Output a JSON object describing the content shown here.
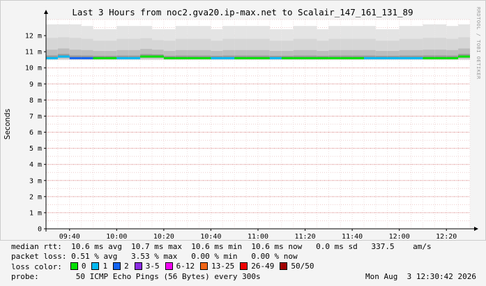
{
  "chart_data": {
    "type": "area",
    "title": "Last 3 Hours from noc2.gva20.ip-max.net to Scalair_147_161_131_89",
    "ylabel": "Seconds",
    "ylim": [
      0,
      0.013
    ],
    "yticks": [
      {
        "value": 0,
        "label": "0"
      },
      {
        "value": 0.001,
        "label": "1 m"
      },
      {
        "value": 0.002,
        "label": "2 m"
      },
      {
        "value": 0.003,
        "label": "3 m"
      },
      {
        "value": 0.004,
        "label": "4 m"
      },
      {
        "value": 0.005,
        "label": "5 m"
      },
      {
        "value": 0.006,
        "label": "6 m"
      },
      {
        "value": 0.007,
        "label": "7 m"
      },
      {
        "value": 0.008,
        "label": "8 m"
      },
      {
        "value": 0.009,
        "label": "9 m"
      },
      {
        "value": 0.01,
        "label": "10 m"
      },
      {
        "value": 0.011,
        "label": "11 m"
      },
      {
        "value": 0.012,
        "label": "12 m"
      }
    ],
    "xticks": [
      "09:40",
      "10:00",
      "10:20",
      "10:40",
      "11:00",
      "11:20",
      "11:40",
      "12:00",
      "12:20"
    ],
    "xtick_positions_min": [
      10,
      30,
      50,
      70,
      90,
      110,
      130,
      150,
      170
    ],
    "xrange_min": [
      0,
      180
    ],
    "grid": true,
    "series": [
      {
        "name": "median rtt",
        "interval_min": 5,
        "values": [
          0.0106,
          0.0107,
          0.0106,
          0.0106,
          0.0106,
          0.0106,
          0.0106,
          0.0106,
          0.0107,
          0.0107,
          0.0106,
          0.0106,
          0.0106,
          0.0106,
          0.0106,
          0.0106,
          0.0106,
          0.0106,
          0.0106,
          0.0106,
          0.0106,
          0.0106,
          0.0106,
          0.0106,
          0.0106,
          0.0106,
          0.0106,
          0.0106,
          0.0106,
          0.0106,
          0.0106,
          0.0106,
          0.0106,
          0.0106,
          0.0106,
          0.0107
        ],
        "loss_colors": [
          "#00b8f0",
          "#00b8f0",
          "#1464f0",
          "#1464f0",
          "#00e000",
          "#00e000",
          "#00b8f0",
          "#00b8f0",
          "#00e000",
          "#00e000",
          "#00e000",
          "#00e000",
          "#00e000",
          "#00e000",
          "#00b8f0",
          "#00b8f0",
          "#00e000",
          "#00e000",
          "#00e000",
          "#00b8f0",
          "#00e000",
          "#00e000",
          "#00e000",
          "#00e000",
          "#00e000",
          "#00e000",
          "#00e000",
          "#00b8f0",
          "#00b8f0",
          "#00b8f0",
          "#00b8f0",
          "#00b8f0",
          "#00e000",
          "#00e000",
          "#00e000",
          "#00e000"
        ],
        "smoke_top": [
          0.0127,
          0.0127,
          0.0127,
          0.0126,
          0.0124,
          0.0124,
          0.0126,
          0.0126,
          0.0126,
          0.0124,
          0.0124,
          0.0126,
          0.0126,
          0.0126,
          0.0124,
          0.0126,
          0.0126,
          0.0126,
          0.0126,
          0.0124,
          0.0124,
          0.0126,
          0.0126,
          0.0124,
          0.0126,
          0.0126,
          0.0126,
          0.0126,
          0.0124,
          0.0124,
          0.0126,
          0.0126,
          0.0127,
          0.0127,
          0.0126,
          0.0127
        ],
        "smoke_bottom": [
          0.0105,
          0.0105,
          0.0105,
          0.0105,
          0.0105,
          0.0105,
          0.0105,
          0.0105,
          0.0105,
          0.0105,
          0.0105,
          0.0105,
          0.0105,
          0.0105,
          0.0105,
          0.0105,
          0.0105,
          0.0105,
          0.0105,
          0.0105,
          0.0105,
          0.0105,
          0.0105,
          0.0105,
          0.0105,
          0.0105,
          0.0105,
          0.0105,
          0.0105,
          0.0105,
          0.0105,
          0.0105,
          0.0105,
          0.0105,
          0.0105,
          0.0105
        ]
      }
    ]
  },
  "side_label": "RRDTOOL / TOBI OETIKER",
  "stats": {
    "median_rtt": "median rtt:  10.6 ms avg  10.7 ms max  10.6 ms min  10.6 ms now   0.0 ms sd   337.5    am/s",
    "packet_loss": "packet loss: 0.51 % avg   3.53 % max   0.00 % min   0.00 % now",
    "loss_color_label": "loss color:",
    "legend": [
      {
        "label": "0",
        "color": "#00e000"
      },
      {
        "label": "1",
        "color": "#00b8f0"
      },
      {
        "label": "2",
        "color": "#1464f0"
      },
      {
        "label": "3-5",
        "color": "#8a2be2"
      },
      {
        "label": "6-12",
        "color": "#f000f0"
      },
      {
        "label": "13-25",
        "color": "#f06414"
      },
      {
        "label": "26-49",
        "color": "#f00000"
      },
      {
        "label": "50/50",
        "color": "#a00000"
      }
    ],
    "probe": "probe:        50 ICMP Echo Pings (56 Bytes) every 300s",
    "date": "Mon Aug  3 12:30:42 2026"
  }
}
